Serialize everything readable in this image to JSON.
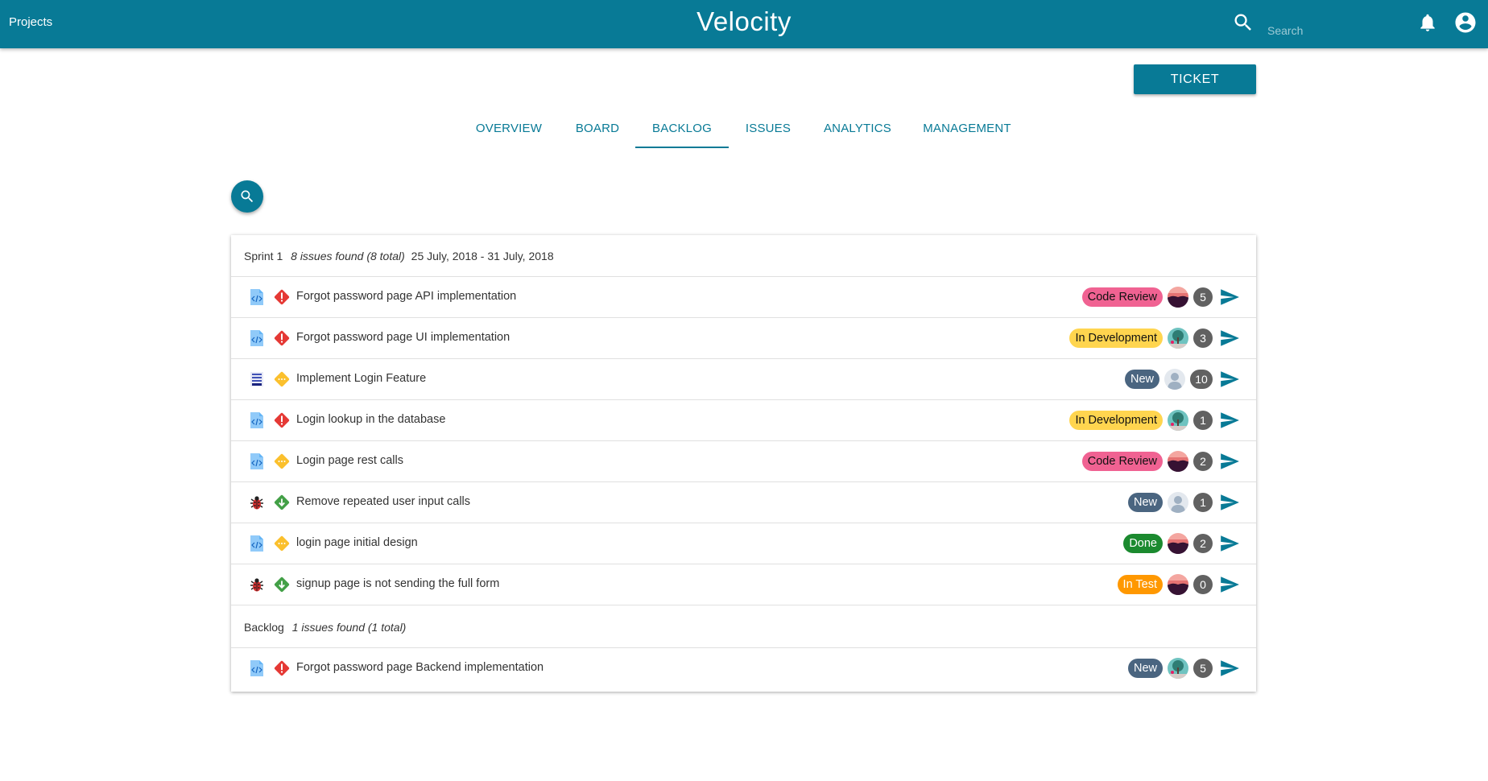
{
  "header": {
    "projects_label": "Projects",
    "app_title": "Velocity",
    "search_placeholder": "Search",
    "accent": "#087a96"
  },
  "ticket_button": {
    "label": "TICKET"
  },
  "tabs": [
    {
      "label": "OVERVIEW",
      "active": false
    },
    {
      "label": "BOARD",
      "active": false
    },
    {
      "label": "BACKLOG",
      "active": true
    },
    {
      "label": "ISSUES",
      "active": false
    },
    {
      "label": "ANALYTICS",
      "active": false
    },
    {
      "label": "MANAGEMENT",
      "active": false
    }
  ],
  "sprint": {
    "name": "Sprint 1",
    "found": "8 issues found (8 total)",
    "dates": "25 July, 2018 - 31 July, 2018",
    "issues": [
      {
        "type": "code-story-icon",
        "priority": "high-priority-icon",
        "summary": "Forgot password page API implementation",
        "status": "Code Review",
        "status_color": "#f06292",
        "avatar": "sunset-avatar",
        "count": "5"
      },
      {
        "type": "code-story-icon",
        "priority": "high-priority-icon",
        "summary": "Forgot password page UI implementation",
        "status": "In Development",
        "status_color": "#ffd54f",
        "avatar": "tree-avatar",
        "count": "3"
      },
      {
        "type": "epic-list-icon",
        "priority": "medium-priority-icon",
        "summary": "Implement Login Feature",
        "status": "New",
        "status_color": "#4a6580",
        "avatar": "default-user-avatar",
        "count": "10"
      },
      {
        "type": "code-story-icon",
        "priority": "high-priority-icon",
        "summary": "Login lookup in the database",
        "status": "In Development",
        "status_color": "#ffd54f",
        "avatar": "tree-avatar",
        "count": "1"
      },
      {
        "type": "code-story-icon",
        "priority": "medium-priority-icon",
        "summary": "Login page rest calls",
        "status": "Code Review",
        "status_color": "#f06292",
        "avatar": "sunset-avatar",
        "count": "2"
      },
      {
        "type": "bug-icon",
        "priority": "low-priority-icon",
        "summary": "Remove repeated user input calls",
        "status": "New",
        "status_color": "#4a6580",
        "avatar": "default-user-avatar",
        "count": "1"
      },
      {
        "type": "code-story-icon",
        "priority": "medium-priority-icon",
        "summary": "login page initial design",
        "status": "Done",
        "status_color": "#1b8a2f",
        "avatar": "sunset-avatar",
        "count": "2"
      },
      {
        "type": "bug-icon",
        "priority": "low-priority-icon",
        "summary": "signup page is not sending the full form",
        "status": "In Test",
        "status_color": "#ff9800",
        "avatar": "sunset-avatar",
        "count": "0"
      }
    ]
  },
  "backlog": {
    "name": "Backlog",
    "found": "1 issues found (1 total)",
    "issues": [
      {
        "type": "code-story-icon",
        "priority": "high-priority-icon",
        "summary": "Forgot password page Backend implementation",
        "status": "New",
        "status_color": "#4a6580",
        "avatar": "tree-avatar",
        "count": "5"
      }
    ]
  }
}
